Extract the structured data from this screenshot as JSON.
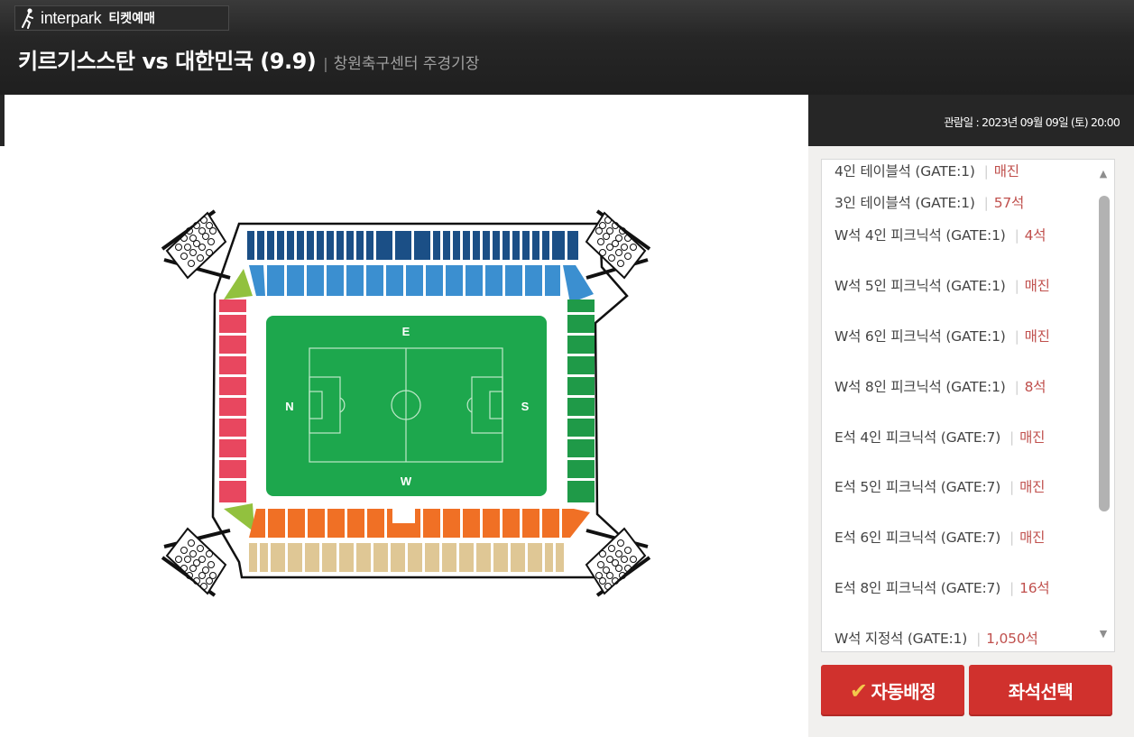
{
  "header": {
    "logo_brand": "interpark",
    "logo_sub": "티켓예매",
    "title": "키르기스스탄 vs 대한민국 (9.9)",
    "separator": "|",
    "venue": "창원축구센터 주경기장"
  },
  "sidebar": {
    "date_line": "관람일 : 2023년 09월 09일 (토) 20:00",
    "grades": [
      {
        "name": "4인 테이블석 (GATE:1)",
        "count": "매진"
      },
      {
        "name": "3인 테이블석 (GATE:1)",
        "count": "57석"
      },
      {
        "name": "W석 4인 피크닉석 (GATE:1)",
        "count": "4석"
      },
      {
        "name": "W석 5인 피크닉석 (GATE:1)",
        "count": "매진"
      },
      {
        "name": "W석 6인 피크닉석 (GATE:1)",
        "count": "매진"
      },
      {
        "name": "W석 8인 피크닉석 (GATE:1)",
        "count": "8석"
      },
      {
        "name": "E석 4인 피크닉석 (GATE:7)",
        "count": "매진"
      },
      {
        "name": "E석 5인 피크닉석 (GATE:7)",
        "count": "매진"
      },
      {
        "name": "E석 6인 피크닉석 (GATE:7)",
        "count": "매진"
      },
      {
        "name": "E석 8인 피크닉석 (GATE:7)",
        "count": "16석"
      },
      {
        "name": "W석 지정석 (GATE:1)",
        "count": "1,050석"
      }
    ],
    "auto_assign_label": "자동배정",
    "select_seat_label": "좌석선택"
  },
  "map": {
    "label_e": "E",
    "label_w": "W",
    "label_n": "N",
    "label_s": "S"
  },
  "colors": {
    "header_bg": "#262626",
    "button": "#d0312d",
    "sold_out": "#c0504d",
    "east_upper": "#1b4f86",
    "east_lower": "#3b8fd0",
    "north": "#e8475f",
    "south": "#1f9a48",
    "west_lower": "#f07025",
    "west_upper": "#dfc795",
    "corner": "#92c13e",
    "pitch": "#1da74d"
  }
}
